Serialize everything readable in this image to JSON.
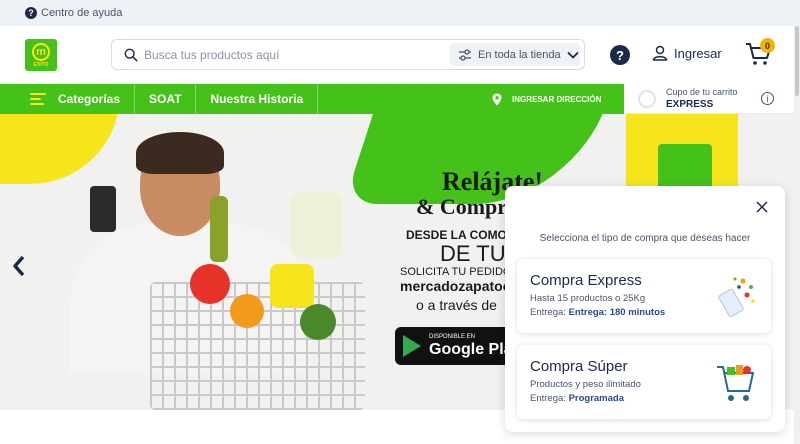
{
  "topbar": {
    "help_label": "Centro de ayuda"
  },
  "header": {
    "logo_text": "EXITO",
    "search_placeholder": "Busca tus productos aquí",
    "search_scope": "En toda la tienda",
    "login_label": "Ingresar",
    "cart_count": "0"
  },
  "nav": {
    "categories_label": "Categorías",
    "items": [
      {
        "label": "SOAT"
      },
      {
        "label": "Nuestra Historia"
      }
    ],
    "address_label": "INGRESAR DIRECCIÓN"
  },
  "cupo": {
    "line1": "Cupo de tu carrito",
    "line2": "EXPRESS"
  },
  "banner": {
    "h1": "Relájate!",
    "h2": "& Compra",
    "h3": "DESDE LA COMODIDAD",
    "h4": "DE TU HOGAR",
    "h5": "SOLICITA TU PEDIDO EN",
    "h6": "mercadozapatoca.com",
    "h7": "o a través de",
    "store_small": "DISPONIBLE EN",
    "store_big": "Google Play"
  },
  "modal": {
    "prompt": "Selecciona el tipo de compra que deseas hacer",
    "options": [
      {
        "title": "Compra Express",
        "desc": "Hasta 15 productos o 25Kg",
        "delivery_prefix": "Entrega:",
        "delivery_value": "Entrega: 180 minutos"
      },
      {
        "title": "Compra Súper",
        "desc": "Productos y peso ilimitado",
        "delivery_prefix": "Entrega:",
        "delivery_value": "Programada"
      }
    ]
  },
  "colors": {
    "brand_green": "#44c21a",
    "brand_yellow": "#f5e51a",
    "navy": "#1c2a4a"
  },
  "icons": [
    "question-icon",
    "search-icon",
    "filter-icon",
    "chevron-down-icon",
    "user-icon",
    "cart-icon",
    "hamburger-icon",
    "location-pin-icon",
    "info-icon",
    "chevron-left-icon",
    "close-icon"
  ]
}
